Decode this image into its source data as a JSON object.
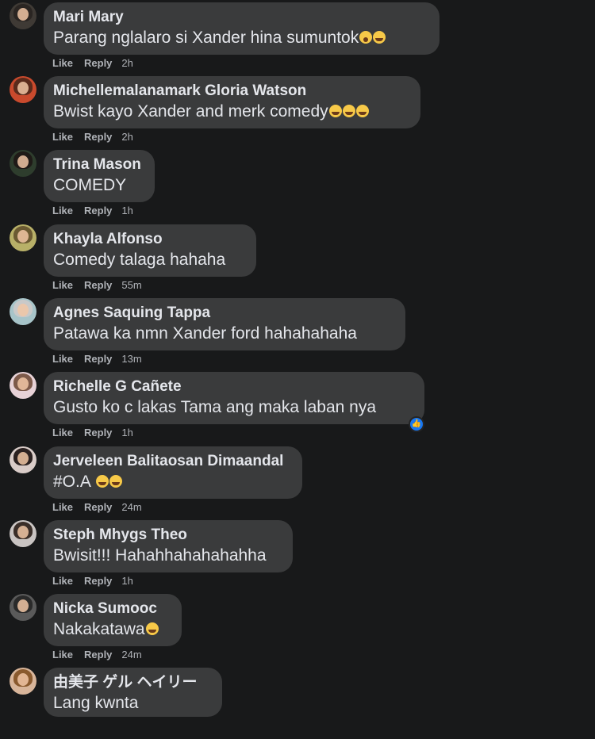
{
  "comments": [
    {
      "author": "Mari Mary",
      "text": "Parang nglalaro si Xander hina sumuntok",
      "emojis": [
        "wow",
        "laugh"
      ],
      "like": "Like",
      "reply": "Reply",
      "time": "2h",
      "avatar_bg": "#3f3a35",
      "hair": "#2a2522"
    },
    {
      "author": "Michellemalanamark Gloria Watson",
      "text": "Bwist kayo Xander and merk comedy",
      "emojis": [
        "laugh",
        "laugh",
        "laugh"
      ],
      "like": "Like",
      "reply": "Reply",
      "time": "2h",
      "avatar_bg": "#c94a2d",
      "hair": "#5a2b1c"
    },
    {
      "author": "Trina Mason",
      "text": "COMEDY",
      "emojis": [],
      "like": "Like",
      "reply": "Reply",
      "time": "1h",
      "avatar_bg": "#2e3d2d",
      "hair": "#1f1a17"
    },
    {
      "author": "Khayla Alfonso",
      "text": "Comedy talaga hahaha",
      "emojis": [],
      "like": "Like",
      "reply": "Reply",
      "time": "55m",
      "avatar_bg": "#b8b068",
      "hair": "#6b5a32"
    },
    {
      "author": "Agnes Saquing Tappa",
      "text": "Patawa ka nmn Xander ford hahahahaha",
      "emojis": [],
      "like": "Like",
      "reply": "Reply",
      "time": "13m",
      "avatar_bg": "#a7c4c9",
      "hair": "#c9c9c9"
    },
    {
      "author": "Richelle G Cañete",
      "text": "Gusto ko c lakas Tama ang maka laban nya",
      "emojis": [],
      "like": "Like",
      "reply": "Reply",
      "time": "1h",
      "avatar_bg": "#e7d2d7",
      "hair": "#7d5a4a",
      "reaction": "like"
    },
    {
      "author": "Jerveleen Balitaosan Dimaandal",
      "text": "#O.A ",
      "emojis": [
        "laugh",
        "laugh"
      ],
      "like": "Like",
      "reply": "Reply",
      "time": "24m",
      "avatar_bg": "#d9ccc8",
      "hair": "#2b2120"
    },
    {
      "author": "Steph Mhygs Theo",
      "text": "Bwisit!!! Hahahhahahahahha",
      "emojis": [],
      "like": "Like",
      "reply": "Reply",
      "time": "1h",
      "avatar_bg": "#c9c4c2",
      "hair": "#3a2e28"
    },
    {
      "author": "Nicka Sumooc",
      "text": "Nakakatawa",
      "emojis": [
        "laugh"
      ],
      "like": "Like",
      "reply": "Reply",
      "time": "24m",
      "avatar_bg": "#5a5a5a",
      "hair": "#2a2a2a"
    },
    {
      "author": "由美子 ゲル ヘイリー",
      "text": "Lang kwnta",
      "emojis": [],
      "like": "Like",
      "reply": "Reply",
      "time": "",
      "avatar_bg": "#d8b59a",
      "hair": "#8a5a2e"
    }
  ]
}
